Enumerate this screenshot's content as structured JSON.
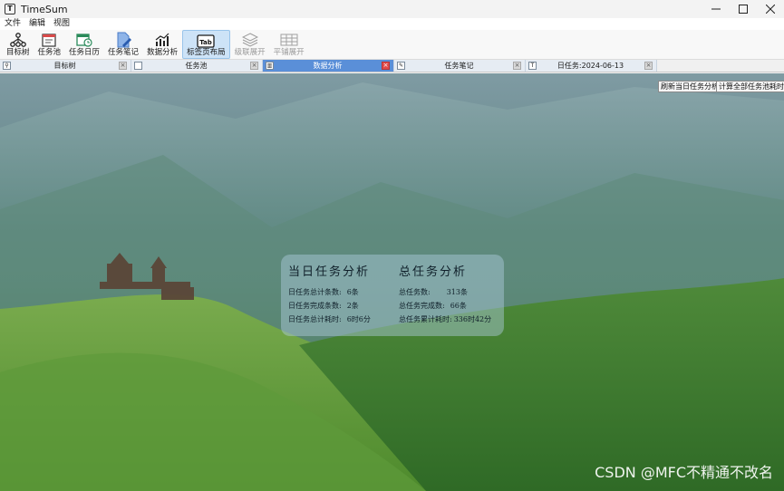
{
  "window": {
    "title": "TimeSum",
    "app_icon": "T"
  },
  "menu": [
    "文件",
    "编辑",
    "视图"
  ],
  "toolbar": [
    {
      "label": "目标树",
      "icon": "tree-icon",
      "state": "normal"
    },
    {
      "label": "任务池",
      "icon": "calendar-icon",
      "state": "normal"
    },
    {
      "label": "任务日历",
      "icon": "calendar-clock-icon",
      "state": "normal"
    },
    {
      "label": "任务笔记",
      "icon": "note-pen-icon",
      "state": "normal"
    },
    {
      "label": "数据分析",
      "icon": "chart-icon",
      "state": "normal"
    },
    {
      "label": "标签页布局",
      "icon": "tab-icon",
      "icon_text": "Tab",
      "state": "active"
    },
    {
      "label": "级联展开",
      "icon": "layers-icon",
      "state": "disabled"
    },
    {
      "label": "平铺展开",
      "icon": "tile-icon",
      "state": "disabled"
    }
  ],
  "tabs": [
    {
      "label": "目标树",
      "icon": "tree-icon",
      "active": false
    },
    {
      "label": "任务池",
      "icon": "calendar-icon",
      "active": false
    },
    {
      "label": "数据分析",
      "icon": "chart-icon",
      "active": true
    },
    {
      "label": "任务笔记",
      "icon": "note-pen-icon",
      "active": false
    },
    {
      "label": "日任务:2024-06-13",
      "icon": "app-icon",
      "active": false
    }
  ],
  "actions": {
    "refresh_daily": "刷新当日任务分析",
    "calc_total": "计算全部任务池耗时"
  },
  "daily": {
    "title": "当日任务分析",
    "rows": [
      {
        "label": "日任务总计条数:",
        "value": "6条"
      },
      {
        "label": "日任务完成条数:",
        "value": "2条"
      },
      {
        "label": "日任务总计耗时:",
        "value": "6时6分"
      }
    ]
  },
  "total": {
    "title": "总任务分析",
    "rows": [
      {
        "label": "总任务数:",
        "value": "313条"
      },
      {
        "label": "总任务完成数:",
        "value": "66条"
      },
      {
        "label": "总任务累计耗时:",
        "value": "336时42分"
      }
    ]
  },
  "watermark": "CSDN @MFC不精通不改名",
  "colors": {
    "active_tab": "#5a8fd8",
    "close_active": "#e24b4b",
    "toolbar_active": "#cde3f7"
  }
}
